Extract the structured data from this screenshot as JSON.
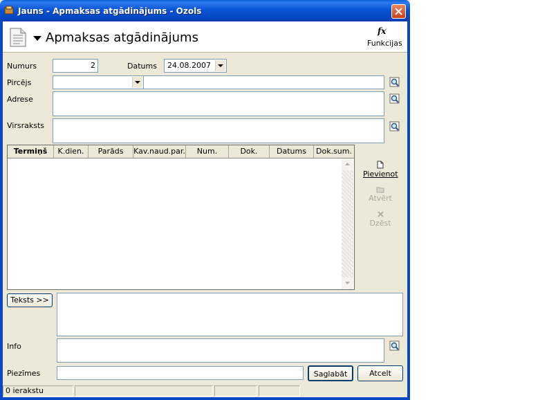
{
  "window": {
    "title": "Jauns - Apmaksas atgādinājums - Ozols"
  },
  "header": {
    "title": "Apmaksas atgādinājums",
    "functions_label": "Funkcijas",
    "fx_glyph": "fx"
  },
  "form": {
    "numurs_label": "Numurs",
    "numurs_value": "2",
    "datums_label": "Datums",
    "datums_value": "24.08.2007",
    "pircejs_label": "Pircējs",
    "pircejs_value": "",
    "pircejs_name": "",
    "adrese_label": "Adrese",
    "adrese_value": "",
    "virsraksts_label": "Virsraksts",
    "virsraksts_value": ""
  },
  "grid": {
    "columns": [
      "Termiņš",
      "K.dien.",
      "Parāds",
      "Kav.naud.par.",
      "Num.",
      "Dok.",
      "Datums",
      "Dok.sum."
    ],
    "rows": []
  },
  "side_actions": {
    "add": "Pievienot",
    "open": "Atvērt",
    "delete": "Dzēst"
  },
  "bottom": {
    "teksts_button": "Teksts >>",
    "teksts_value": "",
    "info_label": "Info",
    "info_value": "",
    "piezimes_label": "Piezīmes",
    "piezimes_value": "",
    "save_button": "Saglabāt",
    "cancel_button": "Atcelt"
  },
  "status": {
    "count": "0 ierakstu"
  },
  "colors": {
    "titlebar": "#0a54d6",
    "window_bg": "#ece9d8",
    "field_border": "#7f9db9",
    "close_button": "#d9542b"
  }
}
